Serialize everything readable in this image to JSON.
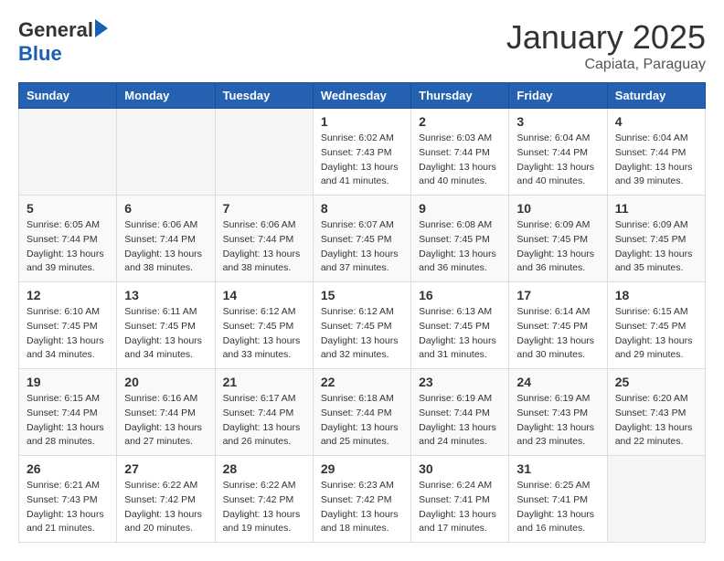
{
  "logo": {
    "general": "General",
    "blue": "Blue"
  },
  "header": {
    "title": "January 2025",
    "subtitle": "Capiata, Paraguay"
  },
  "weekdays": [
    "Sunday",
    "Monday",
    "Tuesday",
    "Wednesday",
    "Thursday",
    "Friday",
    "Saturday"
  ],
  "weeks": [
    [
      {
        "day": "",
        "info": ""
      },
      {
        "day": "",
        "info": ""
      },
      {
        "day": "",
        "info": ""
      },
      {
        "day": "1",
        "info": "Sunrise: 6:02 AM\nSunset: 7:43 PM\nDaylight: 13 hours and 41 minutes."
      },
      {
        "day": "2",
        "info": "Sunrise: 6:03 AM\nSunset: 7:44 PM\nDaylight: 13 hours and 40 minutes."
      },
      {
        "day": "3",
        "info": "Sunrise: 6:04 AM\nSunset: 7:44 PM\nDaylight: 13 hours and 40 minutes."
      },
      {
        "day": "4",
        "info": "Sunrise: 6:04 AM\nSunset: 7:44 PM\nDaylight: 13 hours and 39 minutes."
      }
    ],
    [
      {
        "day": "5",
        "info": "Sunrise: 6:05 AM\nSunset: 7:44 PM\nDaylight: 13 hours and 39 minutes."
      },
      {
        "day": "6",
        "info": "Sunrise: 6:06 AM\nSunset: 7:44 PM\nDaylight: 13 hours and 38 minutes."
      },
      {
        "day": "7",
        "info": "Sunrise: 6:06 AM\nSunset: 7:44 PM\nDaylight: 13 hours and 38 minutes."
      },
      {
        "day": "8",
        "info": "Sunrise: 6:07 AM\nSunset: 7:45 PM\nDaylight: 13 hours and 37 minutes."
      },
      {
        "day": "9",
        "info": "Sunrise: 6:08 AM\nSunset: 7:45 PM\nDaylight: 13 hours and 36 minutes."
      },
      {
        "day": "10",
        "info": "Sunrise: 6:09 AM\nSunset: 7:45 PM\nDaylight: 13 hours and 36 minutes."
      },
      {
        "day": "11",
        "info": "Sunrise: 6:09 AM\nSunset: 7:45 PM\nDaylight: 13 hours and 35 minutes."
      }
    ],
    [
      {
        "day": "12",
        "info": "Sunrise: 6:10 AM\nSunset: 7:45 PM\nDaylight: 13 hours and 34 minutes."
      },
      {
        "day": "13",
        "info": "Sunrise: 6:11 AM\nSunset: 7:45 PM\nDaylight: 13 hours and 34 minutes."
      },
      {
        "day": "14",
        "info": "Sunrise: 6:12 AM\nSunset: 7:45 PM\nDaylight: 13 hours and 33 minutes."
      },
      {
        "day": "15",
        "info": "Sunrise: 6:12 AM\nSunset: 7:45 PM\nDaylight: 13 hours and 32 minutes."
      },
      {
        "day": "16",
        "info": "Sunrise: 6:13 AM\nSunset: 7:45 PM\nDaylight: 13 hours and 31 minutes."
      },
      {
        "day": "17",
        "info": "Sunrise: 6:14 AM\nSunset: 7:45 PM\nDaylight: 13 hours and 30 minutes."
      },
      {
        "day": "18",
        "info": "Sunrise: 6:15 AM\nSunset: 7:45 PM\nDaylight: 13 hours and 29 minutes."
      }
    ],
    [
      {
        "day": "19",
        "info": "Sunrise: 6:15 AM\nSunset: 7:44 PM\nDaylight: 13 hours and 28 minutes."
      },
      {
        "day": "20",
        "info": "Sunrise: 6:16 AM\nSunset: 7:44 PM\nDaylight: 13 hours and 27 minutes."
      },
      {
        "day": "21",
        "info": "Sunrise: 6:17 AM\nSunset: 7:44 PM\nDaylight: 13 hours and 26 minutes."
      },
      {
        "day": "22",
        "info": "Sunrise: 6:18 AM\nSunset: 7:44 PM\nDaylight: 13 hours and 25 minutes."
      },
      {
        "day": "23",
        "info": "Sunrise: 6:19 AM\nSunset: 7:44 PM\nDaylight: 13 hours and 24 minutes."
      },
      {
        "day": "24",
        "info": "Sunrise: 6:19 AM\nSunset: 7:43 PM\nDaylight: 13 hours and 23 minutes."
      },
      {
        "day": "25",
        "info": "Sunrise: 6:20 AM\nSunset: 7:43 PM\nDaylight: 13 hours and 22 minutes."
      }
    ],
    [
      {
        "day": "26",
        "info": "Sunrise: 6:21 AM\nSunset: 7:43 PM\nDaylight: 13 hours and 21 minutes."
      },
      {
        "day": "27",
        "info": "Sunrise: 6:22 AM\nSunset: 7:42 PM\nDaylight: 13 hours and 20 minutes."
      },
      {
        "day": "28",
        "info": "Sunrise: 6:22 AM\nSunset: 7:42 PM\nDaylight: 13 hours and 19 minutes."
      },
      {
        "day": "29",
        "info": "Sunrise: 6:23 AM\nSunset: 7:42 PM\nDaylight: 13 hours and 18 minutes."
      },
      {
        "day": "30",
        "info": "Sunrise: 6:24 AM\nSunset: 7:41 PM\nDaylight: 13 hours and 17 minutes."
      },
      {
        "day": "31",
        "info": "Sunrise: 6:25 AM\nSunset: 7:41 PM\nDaylight: 13 hours and 16 minutes."
      },
      {
        "day": "",
        "info": ""
      }
    ]
  ]
}
